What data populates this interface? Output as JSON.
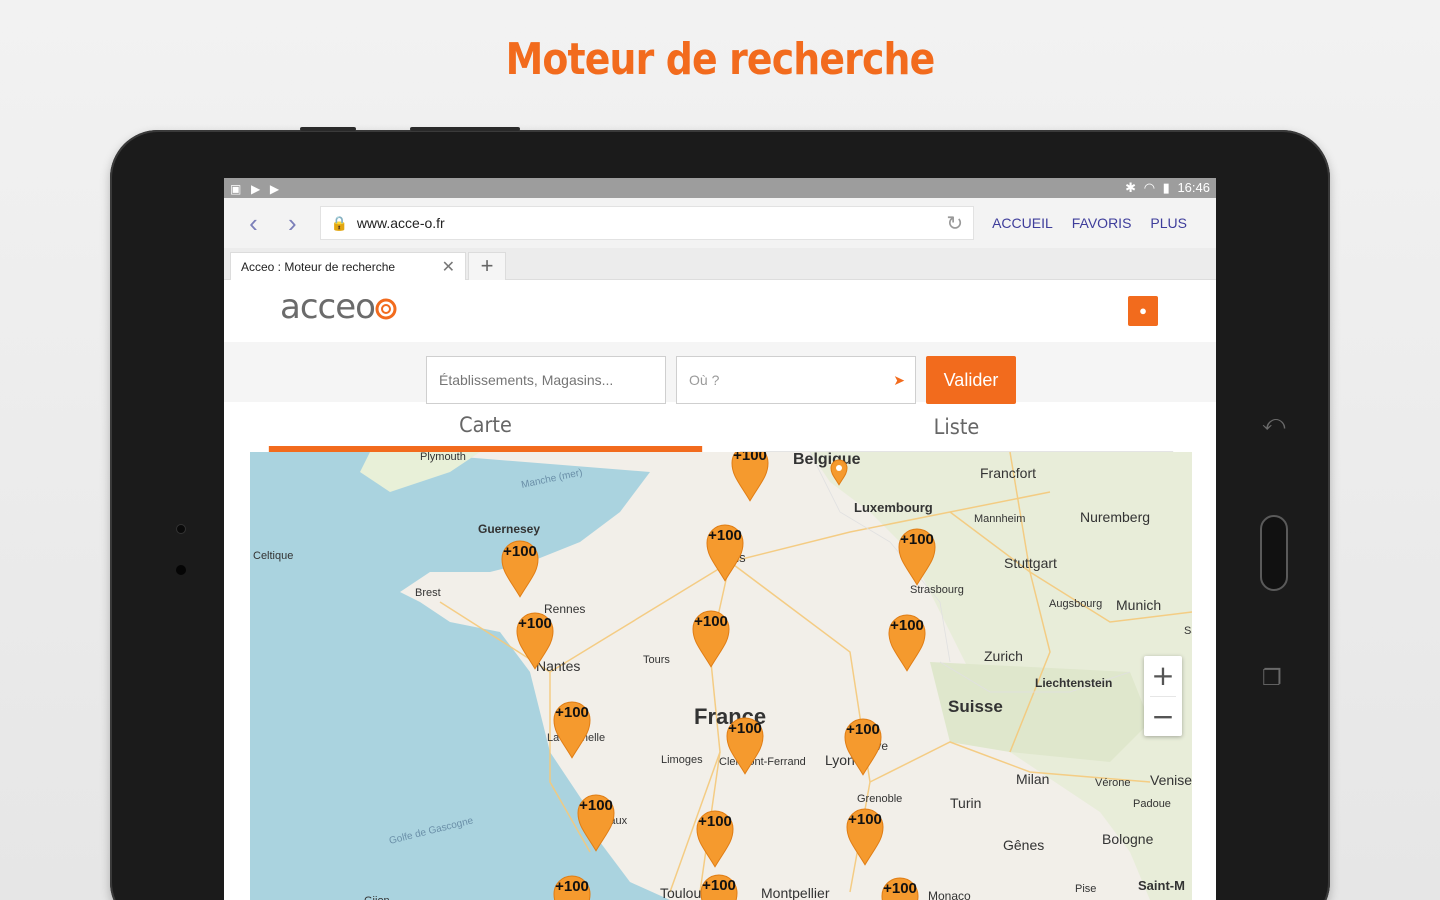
{
  "headline": "Moteur de recherche",
  "status_bar": {
    "time": "16:46"
  },
  "browser": {
    "url": "www.acce-o.fr",
    "menu": [
      "ACCUEIL",
      "FAVORIS",
      "PLUS"
    ],
    "tab_title": "Acceo : Moteur de recherche"
  },
  "site": {
    "logo_text": "acceo",
    "search": {
      "what_placeholder": "Établissements, Magasins...",
      "where_placeholder": "Où ?",
      "submit_label": "Valider"
    },
    "view_tabs": {
      "map": "Carte",
      "list": "Liste"
    }
  },
  "map": {
    "cluster_label": "+100",
    "labels": [
      "Plymouth",
      "Manche (mer)",
      "Belgique",
      "Francfort",
      "Luxembourg",
      "Mannheim",
      "Nuremberg",
      "Guernesey",
      "Celtique",
      "Paris",
      "Stuttgart",
      "Brest",
      "Strasbourg",
      "Augsbourg",
      "Munich",
      "Rennes",
      "Tours",
      "Nantes",
      "Zurich",
      "Liechtenstein",
      "France",
      "Suisse",
      "La Rochelle",
      "Genève",
      "Limoges",
      "Clermont-Ferrand",
      "Lyon",
      "Milan",
      "Vérone",
      "Venise",
      "Padoue",
      "Grenoble",
      "Turin",
      "Bordeaux",
      "Golfe de Gascogne",
      "Gênes",
      "Bologne",
      "Toulouse",
      "Montpellier",
      "Monaco",
      "Pise",
      "Saint-M",
      "Gijon",
      "Sa"
    ],
    "zoom_in": "+",
    "zoom_out": "−"
  },
  "colors": {
    "accent": "#f26b1d",
    "link": "#3e3d9b",
    "sea": "#aad3df",
    "land": "#f2efe9"
  }
}
